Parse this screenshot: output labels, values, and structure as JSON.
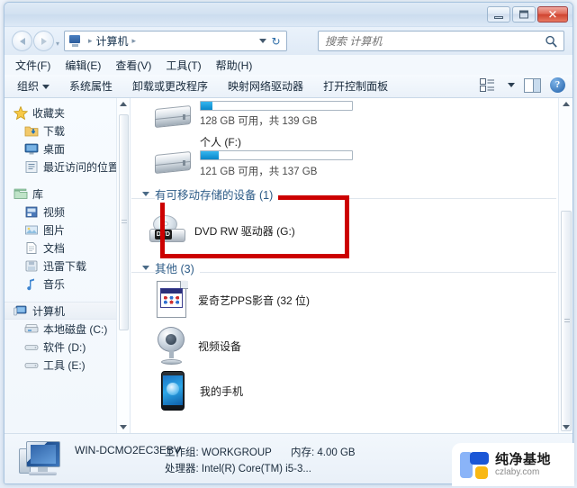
{
  "window": {
    "controls": {
      "minimize": "–",
      "maximize": "□",
      "close": "✕"
    }
  },
  "address": {
    "crumb_root": "计算机",
    "separator": "▸",
    "refresh_label": "↻",
    "dropdown_label": "▾"
  },
  "search": {
    "placeholder": "搜索 计算机",
    "value": ""
  },
  "menubar": {
    "items": [
      {
        "label": "文件(F)"
      },
      {
        "label": "编辑(E)"
      },
      {
        "label": "查看(V)"
      },
      {
        "label": "工具(T)"
      },
      {
        "label": "帮助(H)"
      }
    ]
  },
  "toolbar": {
    "organize": "组织",
    "buttons": [
      {
        "label": "系统属性"
      },
      {
        "label": "卸载或更改程序"
      },
      {
        "label": "映射网络驱动器"
      },
      {
        "label": "打开控制面板"
      }
    ],
    "help_label": "?"
  },
  "sidebar": {
    "groups": [
      {
        "title": "收藏夹",
        "items": [
          {
            "label": "下载"
          },
          {
            "label": "桌面"
          },
          {
            "label": "最近访问的位置"
          }
        ]
      },
      {
        "title": "库",
        "items": [
          {
            "label": "视频"
          },
          {
            "label": "图片"
          },
          {
            "label": "文档"
          },
          {
            "label": "迅雷下载"
          },
          {
            "label": "音乐"
          }
        ]
      },
      {
        "title": "计算机",
        "selected": true,
        "items": [
          {
            "label": "本地磁盘 (C:)"
          },
          {
            "label": "软件 (D:)"
          },
          {
            "label": "工具 (E:)"
          }
        ]
      }
    ]
  },
  "content": {
    "partial_drive": {
      "usage_text": "128 GB 可用，共 139 GB",
      "fill_percent": 8
    },
    "drive_f": {
      "name": "个人 (F:)",
      "usage_text": "121 GB 可用，共 137 GB",
      "fill_percent": 12
    },
    "group_removable": {
      "title": "有可移动存储的设备 (1)",
      "items": [
        {
          "label": "DVD RW 驱动器 (G:)",
          "icon": "dvd-drive-icon",
          "highlighted": true
        }
      ]
    },
    "group_other": {
      "title": "其他 (3)",
      "items": [
        {
          "label": "爱奇艺PPS影音 (32 位)",
          "icon": "pps-file-icon"
        },
        {
          "label": "视频设备",
          "icon": "webcam-icon"
        },
        {
          "label": "我的手机",
          "icon": "phone-icon"
        }
      ]
    }
  },
  "statusbar": {
    "computer_name": "WIN-DCMO2EC3EBV",
    "workgroup_label": "工作组:",
    "workgroup_value": "WORKGROUP",
    "memory_label": "内存:",
    "memory_value": "4.00 GB",
    "processor_label": "处理器:",
    "processor_value": "Intel(R) Core(TM) i5-3..."
  },
  "watermark": {
    "title": "纯净基地",
    "domain": "czlaby.com"
  },
  "colors": {
    "highlight_red": "#cc0000",
    "drive_bar_blue": "#0b87c9",
    "accent_blue": "#1a56d6",
    "accent_yellow": "#f9b814"
  }
}
